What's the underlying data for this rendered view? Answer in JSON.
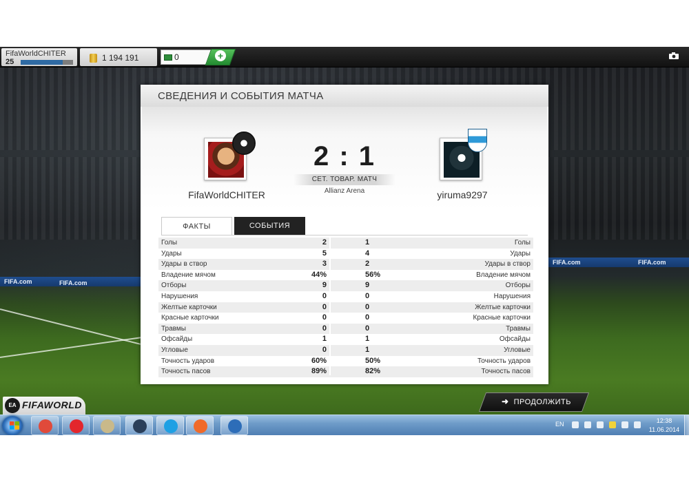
{
  "topbar": {
    "player_name": "FifaWorldCHITER",
    "player_level": "25",
    "xp_progress": 0.8,
    "coins": "1 194 191",
    "fifa_points": "0",
    "add_points_label": "+",
    "camera_icon": "camera-icon"
  },
  "panel": {
    "title": "СВЕДЕНИЯ И СОБЫТИЯ МАТЧА",
    "home_team": "FifaWorldCHITER",
    "away_team": "yiruma9297",
    "score": "2 : 1",
    "match_type": "СЕТ. ТОВАР. МАТЧ",
    "venue": "Allianz Arena",
    "tabs": [
      "ФАКТЫ",
      "СОБЫТИЯ"
    ],
    "active_tab": "ФАКТЫ"
  },
  "stats": [
    {
      "label": "Голы",
      "home": "2",
      "away": "1"
    },
    {
      "label": "Удары",
      "home": "5",
      "away": "4"
    },
    {
      "label": "Удары в створ",
      "home": "3",
      "away": "2"
    },
    {
      "label": "Владение мячом",
      "home": "44%",
      "away": "56%"
    },
    {
      "label": "Отборы",
      "home": "9",
      "away": "9"
    },
    {
      "label": "Нарушения",
      "home": "0",
      "away": "0"
    },
    {
      "label": "Желтые карточки",
      "home": "0",
      "away": "0"
    },
    {
      "label": "Красные карточки",
      "home": "0",
      "away": "0"
    },
    {
      "label": "Травмы",
      "home": "0",
      "away": "0"
    },
    {
      "label": "Офсайды",
      "home": "1",
      "away": "1"
    },
    {
      "label": "Угловые",
      "home": "0",
      "away": "1"
    },
    {
      "label": "Точность ударов",
      "home": "60%",
      "away": "50%"
    },
    {
      "label": "Точность пасов",
      "home": "89%",
      "away": "82%"
    }
  ],
  "bottom": {
    "logo_text": "FIFAWORLD",
    "ea_badge": "EA",
    "continue_label": "ПРОДОЛЖИТЬ",
    "continue_icon": "arrow-right-icon"
  },
  "stadium_ads": [
    "FIFA.com",
    "FIFA.com",
    "FIFA.com",
    "FIFA.com"
  ],
  "taskbar": {
    "language": "EN",
    "clock_time": "12:38",
    "clock_date": "11.06.2014",
    "apps": [
      {
        "name": "chrome",
        "color": "#e04a3a"
      },
      {
        "name": "yandex-browser",
        "color": "#e3262c"
      },
      {
        "name": "tool",
        "color": "#c9b98a"
      },
      {
        "name": "steam",
        "color": "#2a3f5a"
      },
      {
        "name": "skype",
        "color": "#1ea0e4"
      },
      {
        "name": "origin",
        "color": "#f06a2a"
      },
      {
        "name": "fifa-world",
        "color": "#2d6db8"
      }
    ]
  }
}
